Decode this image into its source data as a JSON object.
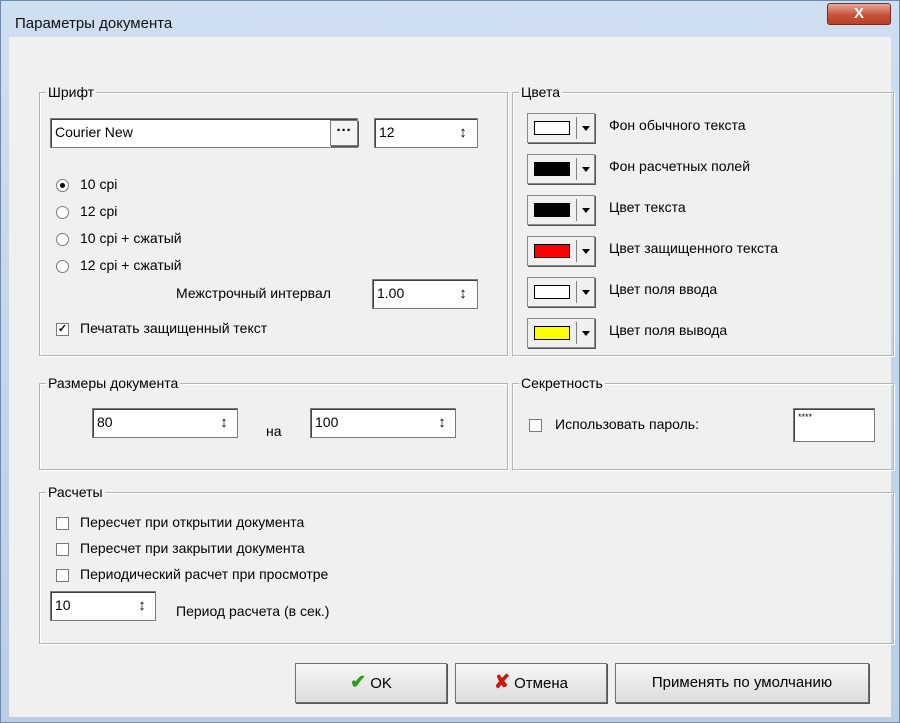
{
  "window": {
    "title": "Параметры документа",
    "close_glyph": "X"
  },
  "font": {
    "legend": "Шрифт",
    "name": "Courier New",
    "browse": "···",
    "size": "12",
    "options": [
      "10 cpi",
      "12 cpi",
      "10 cpi + сжатый",
      "12 cpi + сжатый"
    ],
    "selected_index": 0,
    "line_spacing_label": "Межстрочный интервал",
    "line_spacing": "1.00",
    "print_protected_label": "Печатать защищенный текст",
    "print_protected": true
  },
  "colors": {
    "legend": "Цвета",
    "items": [
      {
        "label": "Фон обычного текста",
        "color": "#ffffff"
      },
      {
        "label": "Фон расчетных полей",
        "color": "#000000"
      },
      {
        "label": "Цвет текста",
        "color": "#000000"
      },
      {
        "label": "Цвет защищенного текста",
        "color": "#ff0000"
      },
      {
        "label": "Цвет поля ввода",
        "color": "#ffffff"
      },
      {
        "label": "Цвет поля вывода",
        "color": "#ffff00"
      }
    ]
  },
  "size": {
    "legend": "Размеры документа",
    "width": "80",
    "by": "на",
    "height": "100"
  },
  "secrecy": {
    "legend": "Секретность",
    "use_password_label": "Использовать пароль:",
    "password": "****"
  },
  "calc": {
    "legend": "Расчеты",
    "options": [
      "Пересчет при открытии документа",
      "Пересчет при закрытии документа",
      "Периодический расчет при просмотре"
    ],
    "period": "10",
    "period_label": "Период расчета (в сек.)"
  },
  "buttons": {
    "ok": "OK",
    "cancel": "Отмена",
    "defaults": "Применять по умолчанию"
  },
  "icons": {
    "spin": "↕",
    "ok": "check-icon",
    "cancel": "x-icon"
  }
}
